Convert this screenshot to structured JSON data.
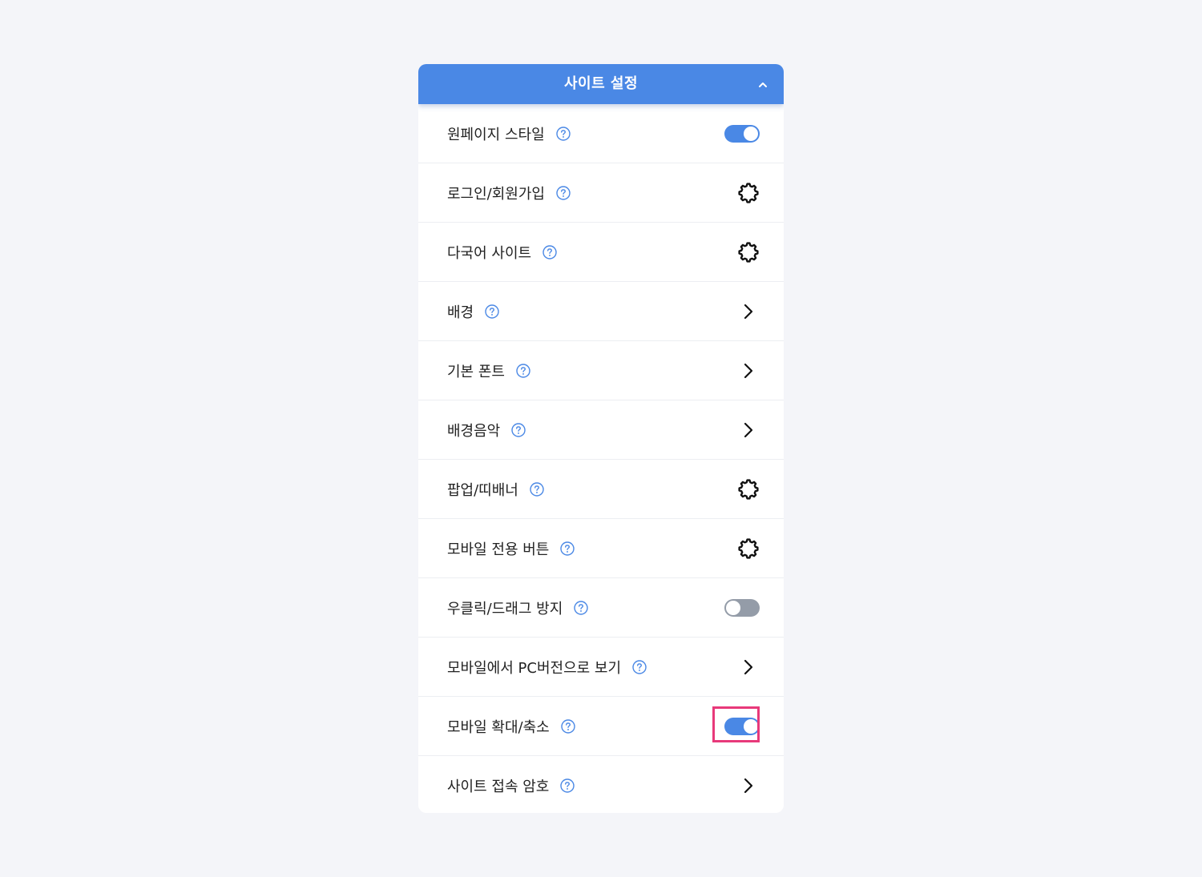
{
  "panel": {
    "title": "사이트 설정",
    "collapse_icon": "chevron-up-icon"
  },
  "settings": [
    {
      "label": "원페이지 스타일",
      "control": "toggle",
      "on": true
    },
    {
      "label": "로그인/회원가입",
      "control": "gear"
    },
    {
      "label": "다국어 사이트",
      "control": "gear"
    },
    {
      "label": "배경",
      "control": "chevron"
    },
    {
      "label": "기본 폰트",
      "control": "chevron"
    },
    {
      "label": "배경음악",
      "control": "chevron"
    },
    {
      "label": "팝업/띠배너",
      "control": "gear"
    },
    {
      "label": "모바일 전용 버튼",
      "control": "gear"
    },
    {
      "label": "우클릭/드래그 방지",
      "control": "toggle",
      "on": false
    },
    {
      "label": "모바일에서 PC버전으로 보기",
      "control": "chevron"
    },
    {
      "label": "모바일 확대/축소",
      "control": "toggle",
      "on": true,
      "highlighted": true
    },
    {
      "label": "사이트 접속 암호",
      "control": "chevron"
    }
  ],
  "colors": {
    "accent": "#4a88e5",
    "toggle_off": "#949ca8",
    "highlight": "#e8397a",
    "background": "#f4f5f9"
  }
}
